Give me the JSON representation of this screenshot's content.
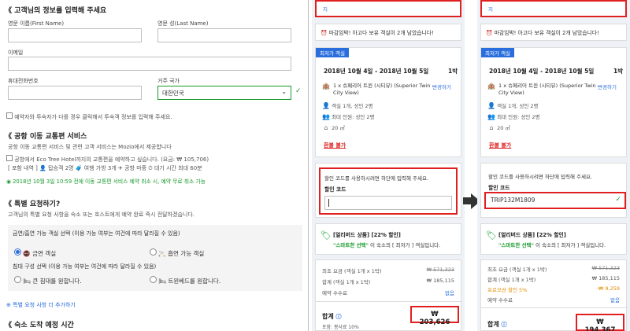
{
  "guest": {
    "section_title": "《 고객님의 정보를 입력해 주세요",
    "first_name_label": "영문 이름(First Name)",
    "last_name_label": "영문 성(Last Name)",
    "email_label": "이메일",
    "phone_label": "휴대전화번호",
    "country_label": "거주 국가",
    "country_value": "대한민국",
    "booker_note": "예약자와 투숙자가 다를 경우 클릭해서 투숙객 정보를 입력해 주세요."
  },
  "airport": {
    "title": "《 공항 이동 교통편 서비스",
    "desc": "공항 이동 교통편 서비스 및 관련 고객 서비스는 Mozio에서 제공합니다",
    "option": "공항에서 Eco Tree Hotel까지의 교통편을 예약하고 싶습니다. (요금: ₩ 105,706)",
    "details": "[ 포함 내역 ]   👤 탑승객 2명   🧳 여행 가방 3개   ✈ 공항 마중   ⏱ 대기 시간 최대 60분",
    "free_cancel": "2018년 10월 3일 10:59 전에 이동 교통편 서비스 예약 취소 시, 예약 무료 취소 가능"
  },
  "special": {
    "title": "《 특별 요청하기?",
    "desc": "고객님의 특별 요청 사항을 숙소 또는 호스트에게 예약 완료 즉시 전달하겠습니다.",
    "smoking_label": "금연/흡연 가능 객실 선택 (이용 가능 여부는 여건에 따라 달라질 수 있음)",
    "nonsmoking": "금연 객실",
    "smoking": "흡연 가능 객실",
    "bed_label": "침대 구성 선택 (이용 가능 여부는 여건에 따라 달라질 수 있음)",
    "bed_large": "큰 침대를 원합니다.",
    "bed_twin": "트윈베드를 원합니다.",
    "add_more": "특별 요청 사항 더 추가하기"
  },
  "arrival": {
    "title": "《 숙소 도착 예정 시간"
  },
  "panels": {
    "top_stub": "지",
    "urgent": "마감임박! 아고다 보유 객실이 2개 남았습니다!",
    "lowest_badge": "최저가 객실",
    "dates": "2018년 10월 4일 - 2018년 10월 5일",
    "nights": "1박",
    "room_name": "1 x 슈페리어 트윈 (시티뷰) (Superior Twin - City View)",
    "change": "변경하기",
    "guests": "객실 1개, 성인 2명",
    "max_guests": "최대 인원: 성인 2명",
    "size": "20 ㎡",
    "non_refund": "환불 불가",
    "promo_prompt": "할인 코드를 사용하시려면 하단에 입력해 주세요.",
    "promo_label": "할인 코드",
    "promo_value": "TRIP132M1809",
    "deal_title": "[얼리버드 상품] [22% 할인]",
    "deal_desc_a": "\"스마트한 선택\"",
    "deal_desc_b": "이 숙소의 [ 최저가 ] 객실입니다.",
    "orig_label": "최초 요금 (객실 1개 x 1박)",
    "orig_price": "₩ 571,323",
    "sum_label": "합계 (객실 1개 x 1박)",
    "sum_price": "₩ 185,115",
    "promo_disc_label": "프로모션 할인 5%",
    "promo_disc_value": "-₩ 9,259",
    "fee_label": "예약 수수료",
    "fee_value": "없음",
    "total_label": "합계",
    "total_left": "₩ 203,626",
    "total_right": "₩ 194,367",
    "tax_note": "포함: 봉사료 10%"
  }
}
